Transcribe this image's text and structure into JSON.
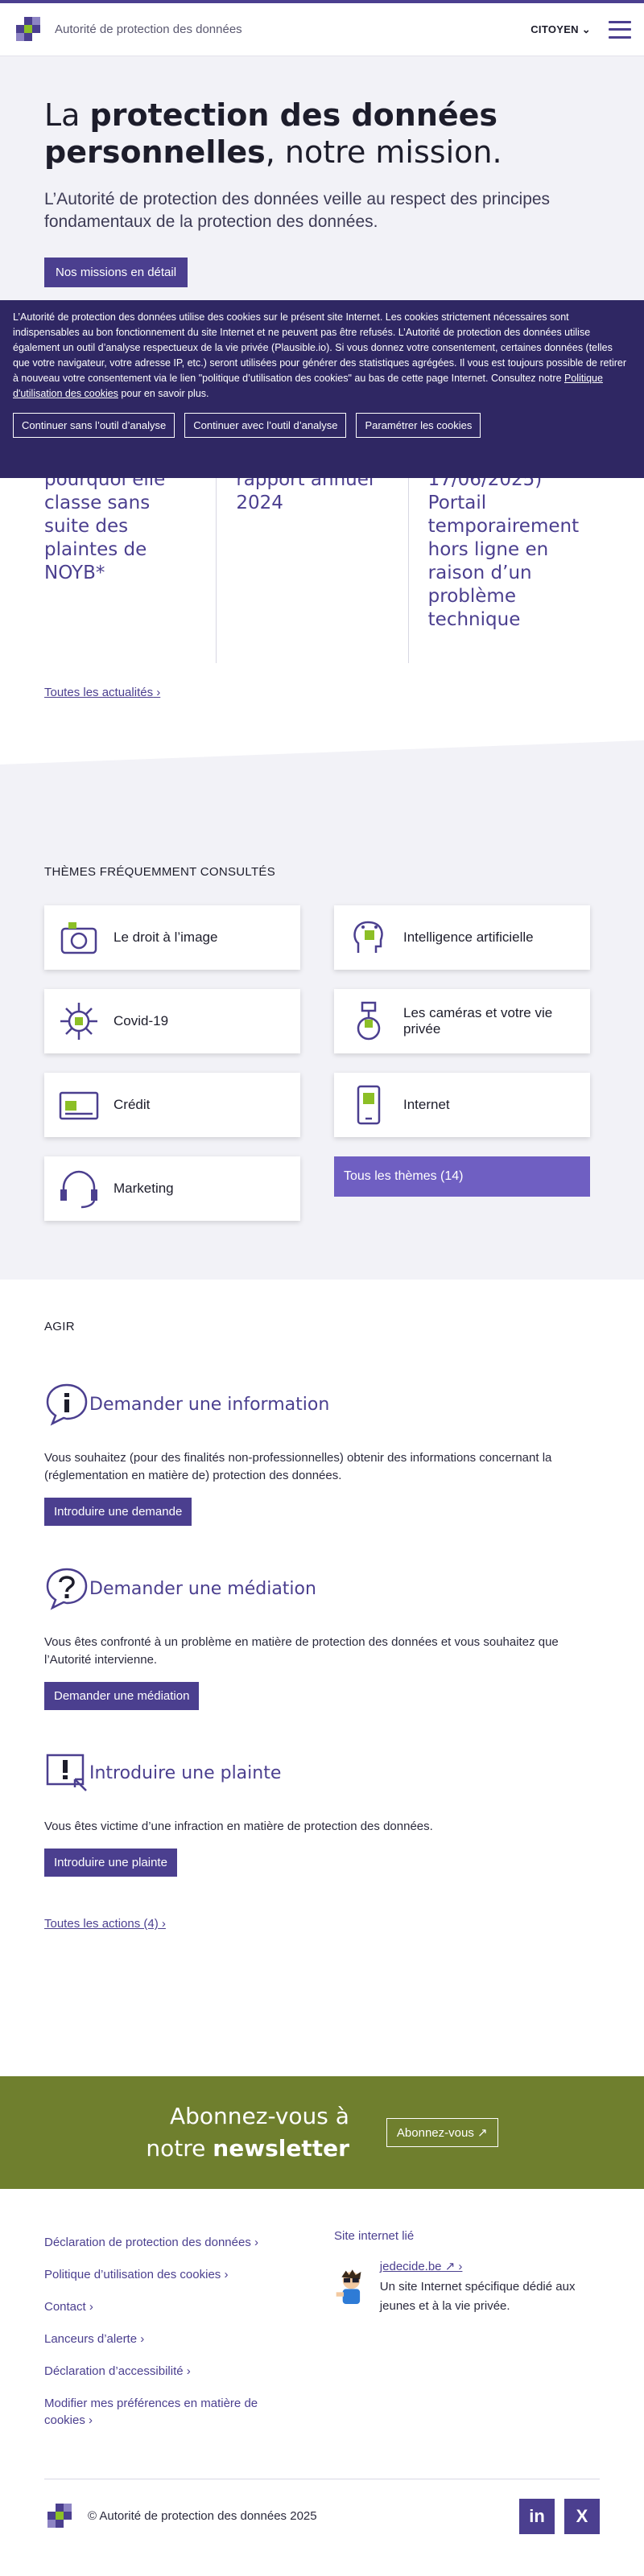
{
  "header": {
    "org_name": "Autorité de protection des données",
    "audience": "CITOYEN"
  },
  "hero": {
    "title_pre": "La ",
    "title_bold": "protection des données personnelles",
    "title_post": ", notre mission.",
    "lead": "L’Autorité de protection des données veille au respect des principes fondamentaux de la protection des données.",
    "cta": "Nos missions en détail"
  },
  "cookie": {
    "text": "L’Autorité de protection des données utilise des cookies sur le présent site Internet. Les cookies strictement nécessaires sont indispensables au bon fonctionnement du site Internet et ne peuvent pas être refusés. L’Autorité de protection des données utilise également un outil d’analyse respectueux de la vie privée (Plausible.io). Si vous donnez votre consentement, certaines données (telles que votre navigateur, votre adresse IP, etc.) seront utilisées pour générer des statistiques agrégées. Il vous est toujours possible de retirer à nouveau votre consentement via le lien \"politique d’utilisation des cookies\" au bas de cette page Internet. Consultez notre ",
    "policy_link": "Politique d'utilisation des cookies",
    "text_end": " pour en savoir plus.",
    "btn_reject": "Continuer sans l’outil d’analyse",
    "btn_accept": "Continuer avec l’outil d’analyse",
    "btn_settings": "Paramétrer les cookies"
  },
  "news": {
    "items": [
      "pourquoi elle classe sans suite des plaintes de NOYB*",
      "rapport annuel 2024",
      "17/06/2025) Portail temporairement hors ligne en raison d’un problème technique"
    ],
    "all_link": "Toutes les actualités"
  },
  "themes": {
    "heading": "THÈMES FRÉQUEMMENT CONSULTÉS",
    "items": [
      {
        "label": "Le droit à l’image",
        "icon": "camera-icon"
      },
      {
        "label": "Intelligence artificielle",
        "icon": "ai-head-icon"
      },
      {
        "label": "Covid-19",
        "icon": "virus-icon"
      },
      {
        "label": "Les caméras et votre vie privée",
        "icon": "cctv-camera-icon"
      },
      {
        "label": "Crédit",
        "icon": "credit-card-icon"
      },
      {
        "label": "Internet",
        "icon": "smartphone-icon"
      },
      {
        "label": "Marketing",
        "icon": "headset-icon"
      }
    ],
    "all_themes": "Tous les thèmes (14)"
  },
  "agir": {
    "heading": "AGIR",
    "actions": [
      {
        "title": "Demander une information",
        "text": "Vous souhaitez (pour des finalités non-professionnelles) obtenir des informations concernant la (réglementation en matière de) protection des données.",
        "button": "Introduire une demande",
        "icon": "info-bubble-icon"
      },
      {
        "title": "Demander une médiation",
        "text": "Vous êtes confronté à un problème en matière de protection des données et vous souhaitez que l’Autorité intervienne.",
        "button": "Demander une médiation",
        "icon": "question-bubble-icon"
      },
      {
        "title": "Introduire une plainte",
        "text": "Vous êtes victime d’une infraction en matière de protection des données.",
        "button": "Introduire une plainte",
        "icon": "complaint-icon"
      }
    ],
    "all_link": "Toutes les actions (4)"
  },
  "newsletter": {
    "line1": "Abonnez-vous à",
    "line2_pre": "notre ",
    "line2_bold": "newsletter",
    "button": "Abonnez-vous"
  },
  "footer": {
    "links": [
      "Déclaration de protection des données",
      "Politique d’utilisation des cookies",
      "Contact",
      "Lanceurs d’alerte",
      "Déclaration d’accessibilité",
      "Modifier mes préférences en matière de cookies"
    ],
    "site_heading": "Site internet lié",
    "site_link": "jedecide.be",
    "site_desc": "Un site Internet spécifique dédié aux jeunes et à la vie privée.",
    "copyright": "© Autorité de protection des données 2025",
    "social": [
      "in",
      "X"
    ]
  },
  "colors": {
    "primary": "#4b3f8f",
    "accent_green": "#8cbf26",
    "newsletter_bg": "#6f7f2e",
    "cookie_bg": "#2f2763"
  }
}
